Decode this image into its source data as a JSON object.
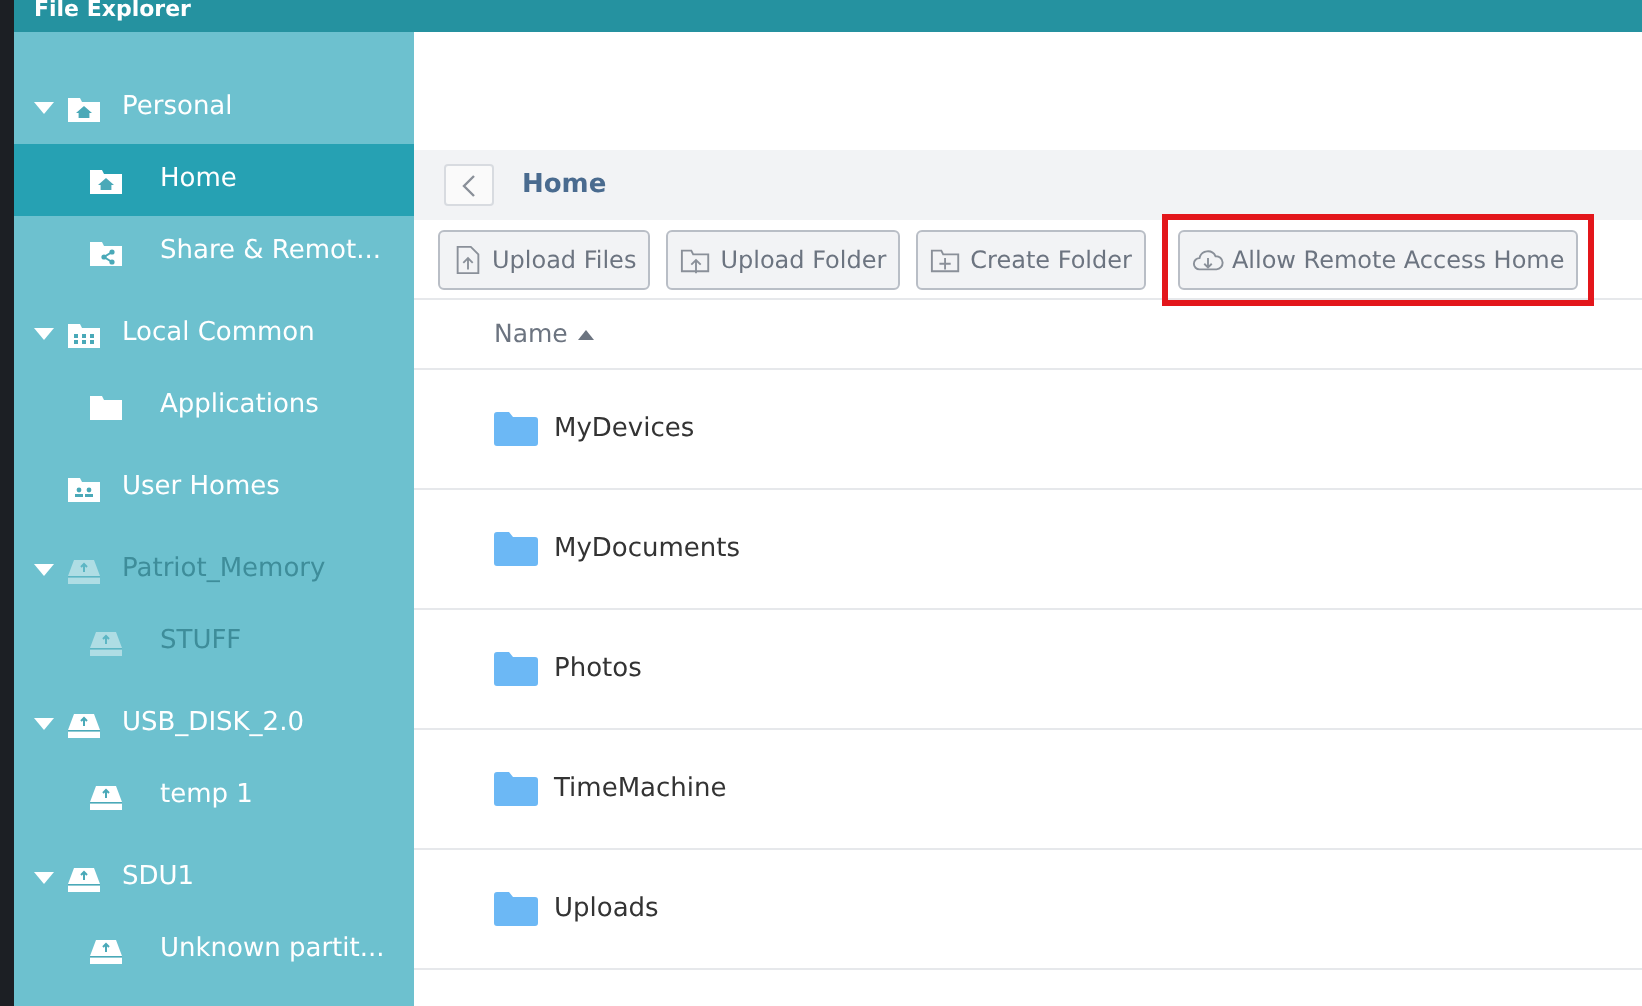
{
  "window": {
    "title": "File Explorer"
  },
  "sidebar": {
    "items": [
      {
        "label": "Personal",
        "kind": "home",
        "expanded": true,
        "selected": false,
        "disabled": false,
        "children": [
          {
            "label": "Home",
            "kind": "home",
            "selected": true,
            "disabled": false
          },
          {
            "label": "Share & Remot...",
            "kind": "share",
            "selected": false,
            "disabled": false
          }
        ]
      },
      {
        "label": "Local Common",
        "kind": "grid",
        "expanded": true,
        "selected": false,
        "disabled": false,
        "children": [
          {
            "label": "Applications",
            "kind": "folder",
            "selected": false,
            "disabled": false
          }
        ]
      },
      {
        "label": "User Homes",
        "kind": "users",
        "selected": false,
        "disabled": false
      },
      {
        "label": "Patriot_Memory",
        "kind": "drive",
        "expanded": true,
        "selected": false,
        "disabled": true,
        "children": [
          {
            "label": "STUFF",
            "kind": "drive",
            "selected": false,
            "disabled": true
          }
        ]
      },
      {
        "label": "USB_DISK_2.0",
        "kind": "drive",
        "expanded": true,
        "selected": false,
        "disabled": false,
        "children": [
          {
            "label": "temp 1",
            "kind": "drive",
            "selected": false,
            "disabled": false
          }
        ]
      },
      {
        "label": "SDU1",
        "kind": "drive",
        "expanded": true,
        "selected": false,
        "disabled": false,
        "children": [
          {
            "label": "Unknown partit...",
            "kind": "drive",
            "selected": false,
            "disabled": false
          }
        ]
      }
    ]
  },
  "breadcrumb": {
    "title": "Home"
  },
  "toolbar": [
    {
      "label": "Upload Files",
      "kind": "upload-file",
      "highlighted": false
    },
    {
      "label": "Upload Folder",
      "kind": "upload-folder",
      "highlighted": false
    },
    {
      "label": "Create Folder",
      "kind": "create-folder",
      "highlighted": false
    },
    {
      "label": "Allow Remote Access Home",
      "kind": "cloud",
      "highlighted": true
    }
  ],
  "table": {
    "columns": [
      {
        "label": "Name",
        "sort_ascending": true
      }
    ],
    "rows": [
      {
        "name": "MyDevices"
      },
      {
        "name": "MyDocuments"
      },
      {
        "name": "Photos"
      },
      {
        "name": "TimeMachine"
      },
      {
        "name": "Uploads"
      }
    ]
  }
}
